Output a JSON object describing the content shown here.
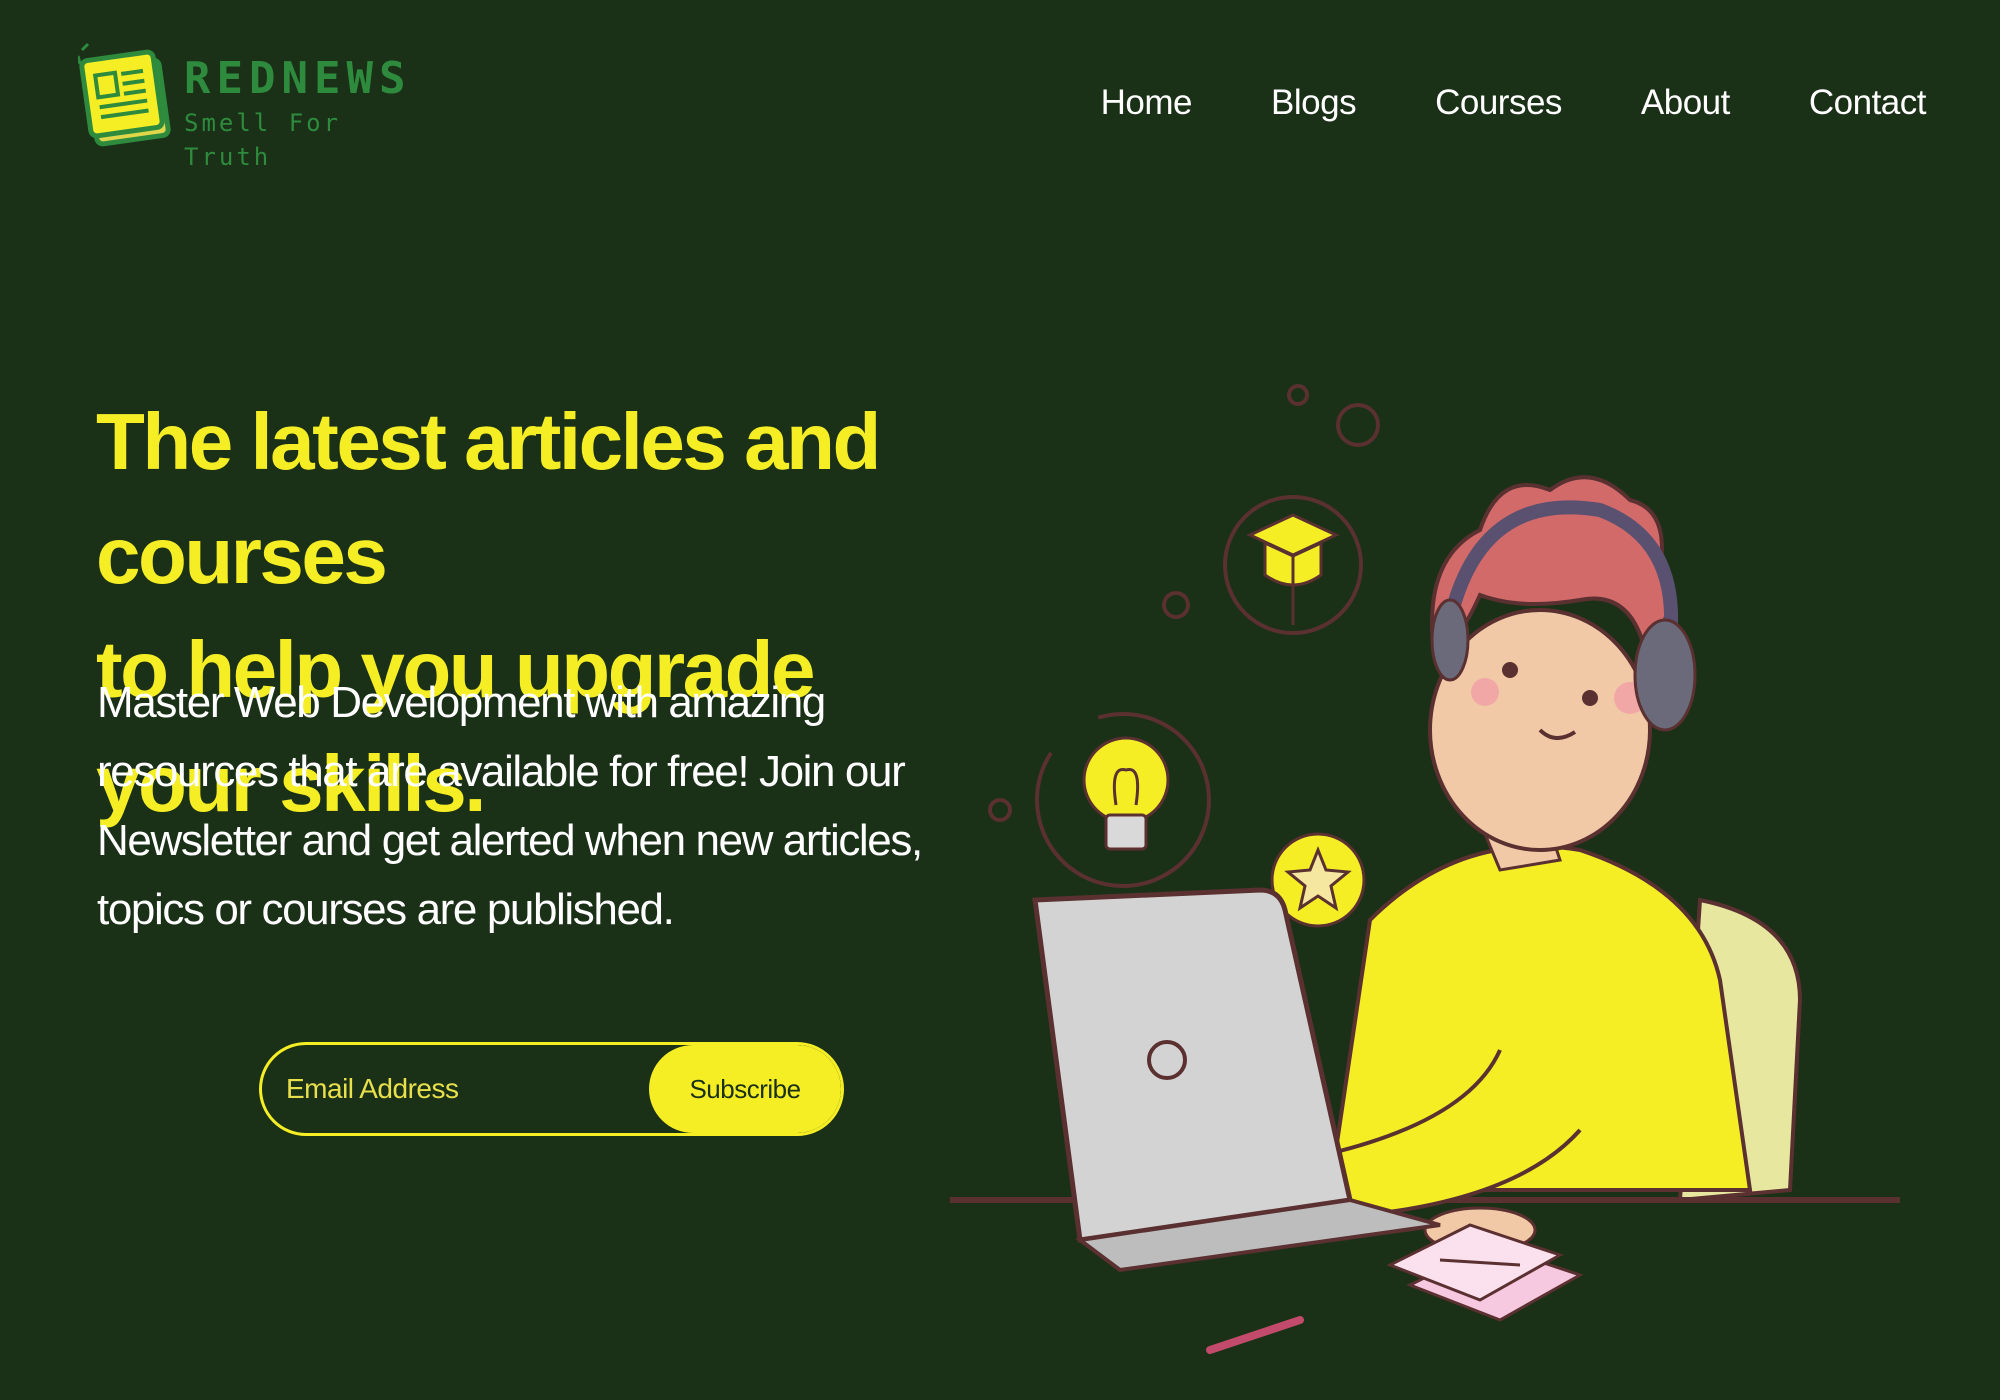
{
  "brand": {
    "name": "REDNEWS",
    "tagline": "Smell For Truth",
    "icon": "newspaper-icon"
  },
  "nav": {
    "items": [
      {
        "label": "Home"
      },
      {
        "label": "Blogs"
      },
      {
        "label": "Courses"
      },
      {
        "label": "About"
      },
      {
        "label": "Contact"
      }
    ]
  },
  "hero": {
    "headline_line1": "The latest articles and courses",
    "headline_line2": "to help you upgrade your skills.",
    "body": "Master Web Development with amazing resources that are available for free! Join our Newsletter and get alerted when new articles, topics or courses are published."
  },
  "newsletter": {
    "email_placeholder": "Email Address",
    "email_value": "",
    "subscribe_label": "Subscribe"
  },
  "colors": {
    "background": "#1a3017",
    "accent": "#f5ee25",
    "brand_green": "#2e8b3e",
    "text": "#ffffff"
  }
}
